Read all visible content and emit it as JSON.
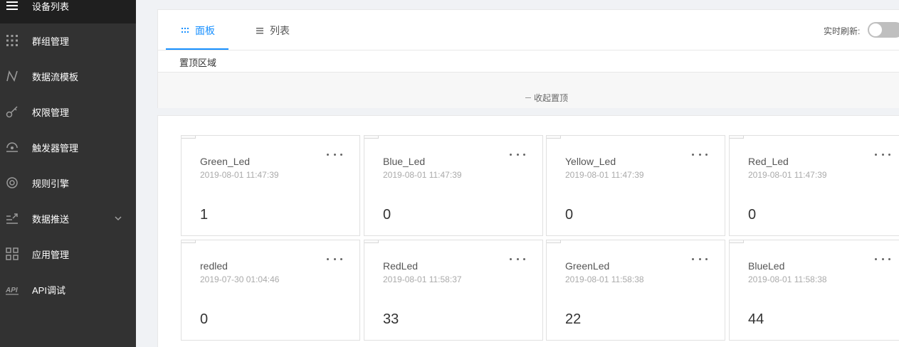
{
  "sidebar": {
    "items": [
      {
        "label": "设备列表",
        "icon": "menu-lines-icon",
        "active": true
      },
      {
        "label": "群组管理",
        "icon": "dots-grid-icon"
      },
      {
        "label": "数据流模板",
        "icon": "dataflow-icon"
      },
      {
        "label": "权限管理",
        "icon": "key-icon"
      },
      {
        "label": "触发器管理",
        "icon": "trigger-icon"
      },
      {
        "label": "规则引擎",
        "icon": "rule-engine-icon"
      },
      {
        "label": "数据推送",
        "icon": "push-icon"
      },
      {
        "label": "应用管理",
        "icon": "app-grid-icon"
      },
      {
        "label": "API调试",
        "icon": "api-icon"
      }
    ]
  },
  "tabs": [
    {
      "label": "面板",
      "icon": "grid-icon",
      "active": true
    },
    {
      "label": "列表",
      "icon": "list-icon"
    }
  ],
  "refresh": {
    "label": "实时刷新:",
    "on": false
  },
  "pinned": {
    "title": "置顶区域",
    "collapse_label": "收起置顶"
  },
  "devices": [
    {
      "name": "Green_Led",
      "time": "2019-08-01 11:47:39",
      "value": "1"
    },
    {
      "name": "Blue_Led",
      "time": "2019-08-01 11:47:39",
      "value": "0"
    },
    {
      "name": "Yellow_Led",
      "time": "2019-08-01 11:47:39",
      "value": "0"
    },
    {
      "name": "Red_Led",
      "time": "2019-08-01 11:47:39",
      "value": "0"
    },
    {
      "name": "redled",
      "time": "2019-07-30 01:04:46",
      "value": "0"
    },
    {
      "name": "RedLed",
      "time": "2019-08-01 11:58:37",
      "value": "33"
    },
    {
      "name": "GreenLed",
      "time": "2019-08-01 11:58:38",
      "value": "22"
    },
    {
      "name": "BlueLed",
      "time": "2019-08-01 11:58:38",
      "value": "44"
    }
  ]
}
